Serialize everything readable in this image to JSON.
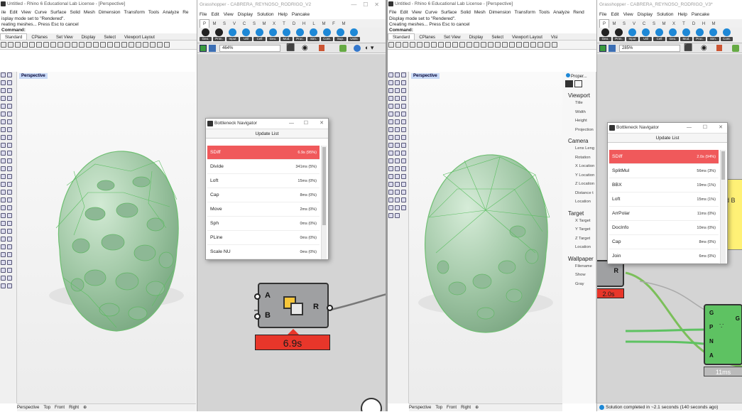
{
  "left": {
    "rhino": {
      "title": "Untitled - Rhino 6 Educational Lab License - [Perspective]",
      "menu": [
        "ile",
        "Edit",
        "View",
        "Curve",
        "Surface",
        "Solid",
        "Mesh",
        "Dimension",
        "Transform",
        "Tools",
        "Analyze",
        "Re"
      ],
      "command_lines": [
        "isplay mode set to \"Rendered\".",
        "reating meshes... Press Esc to cancel",
        "Command:"
      ],
      "tabs": [
        "Standard",
        "CPlanes",
        "Set View",
        "Display",
        "Select",
        "Viewport Layout"
      ],
      "viewport_label": "Perspective",
      "bottom_tabs": [
        "Perspective",
        "Top",
        "Front",
        "Right",
        "⊕"
      ]
    },
    "gh": {
      "title": "Grasshopper - CABRERA_REYNOSO_RODRIGO_V2",
      "menu": [
        "File",
        "Edit",
        "View",
        "Display",
        "Solution",
        "Help",
        "Pancake"
      ],
      "letters": [
        "P",
        "M",
        "S",
        "V",
        "C",
        "S",
        "M",
        "X",
        "T",
        "D",
        "H",
        "L",
        "M",
        "F",
        "M"
      ],
      "ribbon": [
        "Geo.",
        "Prim.",
        "Input",
        "Util",
        "Cell",
        "Geo.",
        "Mod.",
        "Proc.",
        "Sim.",
        "Cont.",
        "Sup.",
        "Units"
      ],
      "zoom": "464%",
      "dialog": {
        "title": "Bottleneck Navigator",
        "button": "Update List",
        "rows": [
          {
            "name": "SDiff",
            "time": "6.9s (95%)",
            "hot": true
          },
          {
            "name": "Divide",
            "time": "341ms (5%)"
          },
          {
            "name": "Loft",
            "time": "15ms (0%)"
          },
          {
            "name": "Cap",
            "time": "8ms (0%)"
          },
          {
            "name": "Move",
            "time": "2ms (0%)"
          },
          {
            "name": "Sph",
            "time": "0ms (0%)"
          },
          {
            "name": "PLine",
            "time": "0ms (0%)"
          },
          {
            "name": "Scale NU",
            "time": "0ms (0%)"
          }
        ]
      },
      "node": {
        "inputs": [
          "A",
          "B"
        ],
        "output": "R",
        "timer": "6.9s"
      }
    }
  },
  "right": {
    "rhino": {
      "title": "Untitled - Rhino 6 Educational Lab License - [Perspective]",
      "menu": [
        "File",
        "Edit",
        "View",
        "Curve",
        "Surface",
        "Solid",
        "Mesh",
        "Dimension",
        "Transform",
        "Tools",
        "Analyze",
        "Rend"
      ],
      "command_lines": [
        "Display mode set to \"Rendered\".",
        "Creating meshes... Press Esc to cancel",
        "Command:"
      ],
      "tabs": [
        "Standard",
        "CPlanes",
        "Set View",
        "Display",
        "Select",
        "Viewport Layout",
        "Visi"
      ],
      "viewport_label": "Perspective",
      "bottom_tabs": [
        "Perspective",
        "Top",
        "Front",
        "Right",
        "⊕"
      ],
      "props_tab": "Proper...",
      "props": [
        {
          "h": "Viewport",
          "items": [
            "Title",
            "Width",
            "Height",
            "Projection"
          ]
        },
        {
          "h": "Camera",
          "items": [
            "Lens Leng",
            "Rotation",
            "X Location",
            "Y Location",
            "Z Location",
            "Distance t",
            "Location"
          ]
        },
        {
          "h": "Target",
          "items": [
            "X Target",
            "Y Target",
            "Z Target",
            "Location"
          ]
        },
        {
          "h": "Wallpaper",
          "items": [
            "Filename",
            "Show",
            "Gray"
          ]
        }
      ]
    },
    "gh": {
      "title": "Grasshopper - CABRERA_REYNOSO_RODRIGO_V3*",
      "menu": [
        "File",
        "Edit",
        "View",
        "Display",
        "Solution",
        "Help",
        "Pancake"
      ],
      "letters": [
        "P",
        "M",
        "S",
        "V",
        "C",
        "S",
        "M",
        "X",
        "T",
        "D",
        "H",
        "M"
      ],
      "ribbon": [
        "Geo.",
        "Prim.",
        "Input",
        "Util",
        "Cell",
        "Geo.",
        "Mod.",
        "Proc.",
        "Sim.",
        "Cont."
      ],
      "zoom": "285%",
      "dialog": {
        "title": "Bottleneck Navigator",
        "button": "Update List",
        "rows": [
          {
            "name": "SDiff",
            "time": "2.0s (94%)",
            "hot": true
          },
          {
            "name": "SplitMul",
            "time": "56ms (3%)"
          },
          {
            "name": "BBX",
            "time": "19ms (1%)"
          },
          {
            "name": "Loft",
            "time": "15ms (1%)"
          },
          {
            "name": "ArrPolar",
            "time": "11ms (0%)"
          },
          {
            "name": "DocInfo",
            "time": "10ms (0%)"
          },
          {
            "name": "Cap",
            "time": "8ms (0%)"
          },
          {
            "name": "Join",
            "time": "6ms (0%)"
          }
        ]
      },
      "yellow_text": "d B",
      "small_node": {
        "output": "R",
        "timer": "2.0s"
      },
      "green_node": {
        "inputs": [
          "G",
          "P",
          "N",
          "A"
        ],
        "output": "G",
        "timer": "11ms"
      },
      "status": "Solution completed in ~2.1 seconds (140 seconds ago)"
    }
  },
  "colors": {
    "hot_row": "#f0595b",
    "timer": "#e8362a",
    "gh_green": "#5ec262",
    "yellow": "#fff176",
    "blob": "#a8cfae"
  }
}
